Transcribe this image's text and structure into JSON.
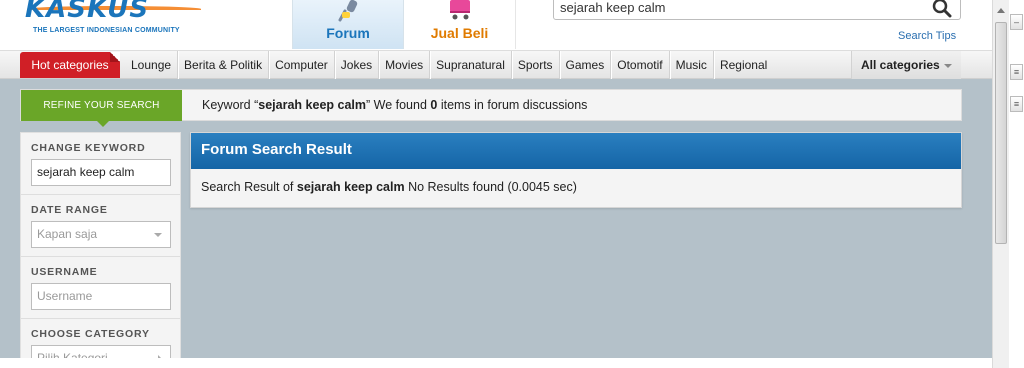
{
  "logo": {
    "name": "KASKUS",
    "tagline": "THE LARGEST INDONESIAN COMMUNITY"
  },
  "tabs": [
    {
      "label": "Forum",
      "icon": "microphone-icon",
      "active": true
    },
    {
      "label": "Jual Beli",
      "icon": "shopping-cart-icon",
      "active": false
    }
  ],
  "search": {
    "value": "sejarah keep calm",
    "tips": "Search Tips"
  },
  "categories": {
    "hot": "Hot categories",
    "items": [
      "Lounge",
      "Berita & Politik",
      "Computer",
      "Jokes",
      "Movies",
      "Supranatural",
      "Sports",
      "Games",
      "Otomotif",
      "Music",
      "Regional"
    ],
    "all": "All categories"
  },
  "refine": {
    "button": "REFINE YOUR SEARCH",
    "msg_prefix": "Keyword “",
    "keyword": "sejarah keep calm",
    "msg_mid": "” We found ",
    "count": "0",
    "msg_suffix": " items in forum discussions"
  },
  "sidebar": {
    "change_keyword_label": "CHANGE KEYWORD",
    "keyword_value": "sejarah keep calm",
    "date_range_label": "DATE RANGE",
    "date_range_value": "Kapan saja",
    "username_label": "USERNAME",
    "username_placeholder": "Username",
    "category_label": "CHOOSE CATEGORY",
    "category_value": "Pilih Kategori"
  },
  "result": {
    "title": "Forum Search Result",
    "prefix": "Search Result of ",
    "keyword": "sejarah keep calm",
    "suffix": " No Results found (0.0045 sec)"
  },
  "colors": {
    "brand_blue": "#1b75bb",
    "brand_orange": "#f58220",
    "hot_red": "#d01f26",
    "refine_green": "#6aa628",
    "panel_blue": "#1565a6",
    "background": "#b4c1c9"
  }
}
